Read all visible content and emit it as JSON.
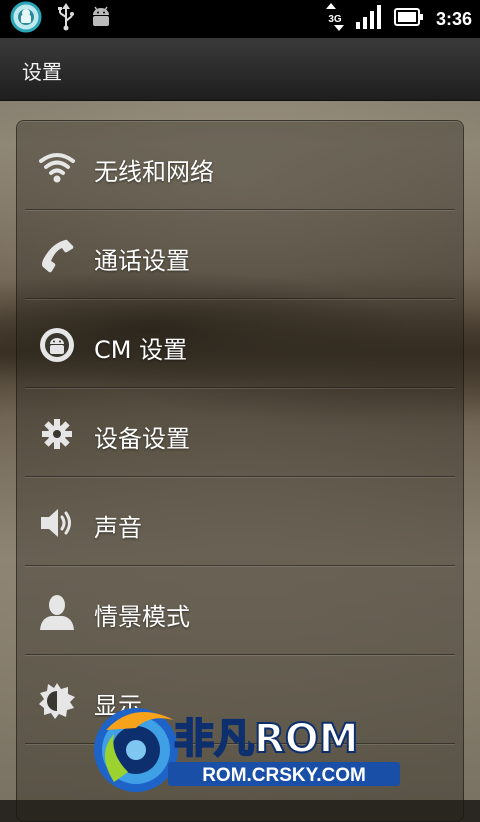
{
  "status_bar": {
    "time": "3:36",
    "network_type": "3G",
    "icons": [
      "cyanogen-notification-icon",
      "usb-icon",
      "android-debug-icon",
      "data-transfer-icon",
      "signal-icon",
      "battery-icon"
    ]
  },
  "header": {
    "title": "设置"
  },
  "settings": {
    "items": [
      {
        "label": "无线和网络",
        "icon": "wifi-icon"
      },
      {
        "label": "通话设置",
        "icon": "phone-icon"
      },
      {
        "label": "CM 设置",
        "icon": "cm-icon"
      },
      {
        "label": "设备设置",
        "icon": "gear-icon"
      },
      {
        "label": "声音",
        "icon": "speaker-icon"
      },
      {
        "label": "情景模式",
        "icon": "person-icon"
      },
      {
        "label": "显示",
        "icon": "brightness-icon"
      }
    ]
  },
  "watermark": {
    "brand": "非凡ROM",
    "url": "ROM.CRSKY.COM"
  }
}
